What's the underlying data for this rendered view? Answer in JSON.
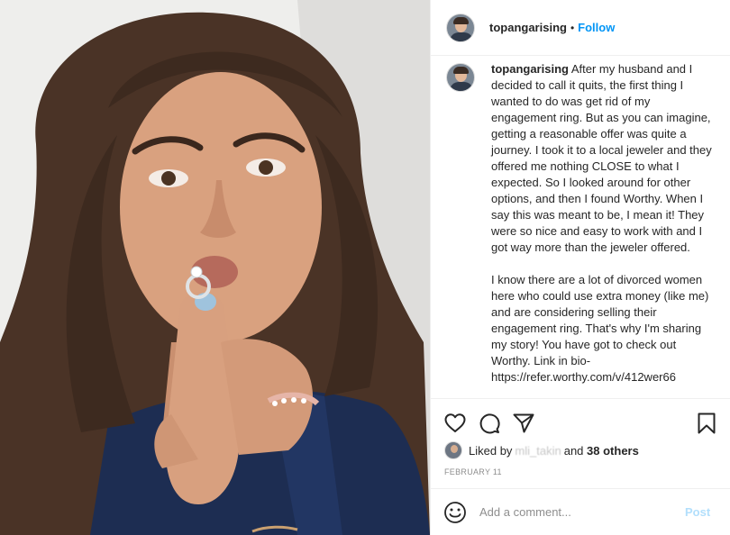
{
  "post": {
    "username": "topangarising",
    "follow_label": "Follow",
    "separator": "•",
    "caption_username": "topangarising",
    "caption_text": " After my husband and I decided to call it quits, the first thing I wanted to do was get rid of my engagement ring. But as you can imagine, getting a reasonable offer was quite a journey. I took it to a local jeweler and they offered me nothing CLOSE to what I expected. So I looked around for other options, and then I found Worthy. When I say this was meant to be, I mean it! They were so nice and easy to work with and I got way more than the jeweler offered.\n\nI know there are a lot of divorced women here who could use extra money (like me) and are considering selling their engagement ring. That's why I'm sharing my story! You have got to check out Worthy. Link in bio-\nhttps://refer.worthy.com/v/412wer66",
    "likes": {
      "prefix": "Liked by",
      "blurred_user": "mli_takin",
      "connector": "and",
      "others": "38 others"
    },
    "date": "FEBRUARY 11",
    "comment": {
      "placeholder": "Add a comment...",
      "post_label": "Post"
    }
  },
  "icons": {
    "like": "heart-outline",
    "comment": "speech-bubble",
    "share": "paper-plane",
    "save": "bookmark",
    "emoji": "smiley-face"
  },
  "colors": {
    "accent": "#0095f6",
    "post_disabled": "#b2dffc",
    "muted": "#8e8e8e",
    "text": "#262626"
  }
}
